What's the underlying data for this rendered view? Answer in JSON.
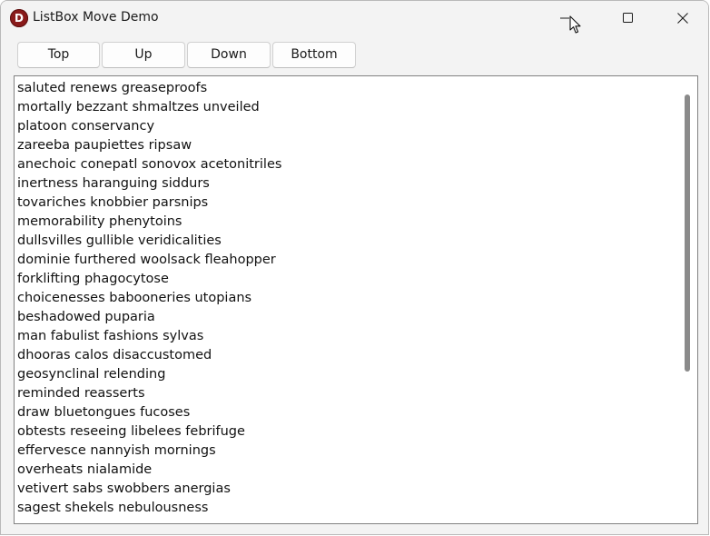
{
  "window": {
    "title": "ListBox Move Demo",
    "app_icon_letter": "D"
  },
  "toolbar": {
    "top_label": "Top",
    "up_label": "Up",
    "down_label": "Down",
    "bottom_label": "Bottom"
  },
  "listbox": {
    "items": [
      "saluted renews greaseproofs",
      "mortally bezzant shmaltzes unveiled",
      "platoon conservancy",
      "zareeba paupiettes ripsaw",
      "anechoic conepatl sonovox acetonitriles",
      "inertness haranguing siddurs",
      "tovariches knobbier parsnips",
      "memorability phenytoins",
      "dullsvilles gullible veridicalities",
      "dominie furthered woolsack fleahopper",
      "forklifting phagocytose",
      "choicenesses babooneries utopians",
      "beshadowed puparia",
      "man fabulist fashions sylvas",
      "dhooras calos disaccustomed",
      "geosynclinal relending",
      "reminded reasserts",
      "draw bluetongues fucoses",
      "obtests reseeing libelees febrifuge",
      "effervesce nannyish mornings",
      "overheats nialamide",
      "vetivert sabs swobbers anergias",
      "sagest shekels nebulousness"
    ]
  },
  "icons": {
    "app": "app-logo-icon",
    "minimize": "minimize-icon",
    "maximize": "maximize-icon",
    "close": "close-icon",
    "cursor": "mouse-pointer-icon"
  },
  "colors": {
    "app_icon": "#8a1a1a",
    "window_bg": "#f3f3f3",
    "list_bg": "#ffffff",
    "scroll_thumb": "#8a8a8a"
  }
}
